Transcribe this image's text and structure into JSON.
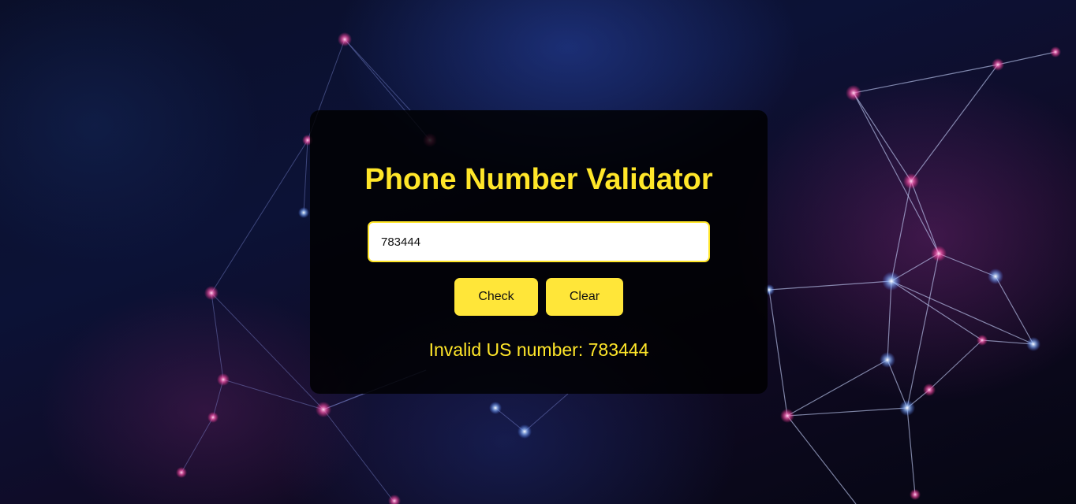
{
  "app": {
    "title": "Phone Number Validator"
  },
  "form": {
    "input_value": "783444",
    "check_label": "Check",
    "clear_label": "Clear"
  },
  "result": {
    "text": "Invalid US number: 783444"
  },
  "colors": {
    "accent": "#ffe629",
    "card_background": "#000000",
    "input_background": "#ffffff"
  }
}
